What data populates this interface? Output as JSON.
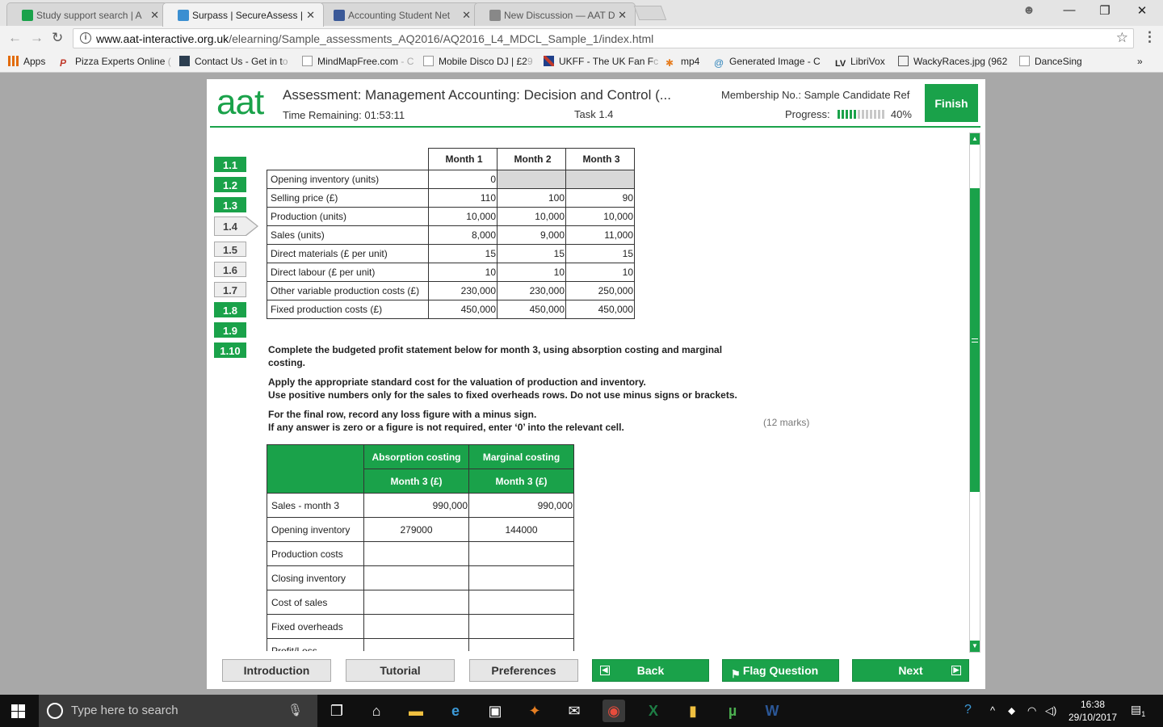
{
  "browser": {
    "tabs": [
      {
        "label": "Study support search | A",
        "favicon_color": "#1aa24a",
        "active": false
      },
      {
        "label": "Surpass | SecureAssess |",
        "favicon_color": "#3b8fd1",
        "active": true
      },
      {
        "label": "Accounting Student Net",
        "favicon_color": "#3b5998",
        "active": false
      },
      {
        "label": "New Discussion — AAT D",
        "favicon_color": "#888888",
        "active": false
      }
    ],
    "window_controls": {
      "profile": "☻",
      "minimize": "—",
      "restore": "❐",
      "close": "✕"
    },
    "url_host": "www.aat-interactive.org.uk",
    "url_path": "/elearning/Sample_assessments_AQ2016/AQ2016_L4_MDCL_Sample_1/index.html",
    "bookmarks": [
      {
        "label": "Apps",
        "tail": "",
        "icon_color": "#e26b0a"
      },
      {
        "label": "Pizza Experts Online",
        "tail": " (",
        "icon_color": "#c0392b"
      },
      {
        "label": "Contact Us - Get in t",
        "tail": "o",
        "icon_color": "#2c3e50"
      },
      {
        "label": "MindMapFree.com",
        "tail": " - C",
        "icon_color": "#ffffff"
      },
      {
        "label": "Mobile Disco DJ | £2",
        "tail": "9",
        "icon_color": "#ffffff"
      },
      {
        "label": "UKFF - The UK Fan F",
        "tail": "c",
        "icon_color": "#c0392b"
      },
      {
        "label": "mp4",
        "tail": "",
        "icon_color": "#e67e22"
      },
      {
        "label": "Generated Image - C",
        "tail": "",
        "icon_color": "#2980b9"
      },
      {
        "label": "LibriVox",
        "tail": "",
        "icon_color": "#333333"
      },
      {
        "label": "WackyRaces.jpg (962",
        "tail": "",
        "icon_color": "#555555"
      },
      {
        "label": "DanceSing",
        "tail": "",
        "icon_color": "#ffffff"
      }
    ],
    "more": "»"
  },
  "assessment": {
    "logo": "aat",
    "title": "Assessment: Management Accounting: Decision and Control (...",
    "time_label": "Time Remaining:",
    "time_value": "01:53:11",
    "task_label": "Task 1.4",
    "membership": "Membership No.: Sample Candidate Ref",
    "progress_label": "Progress:",
    "progress_percent": "40%",
    "progress_fraction": 0.4,
    "finish": "Finish"
  },
  "task_nav": [
    {
      "label": "1.1",
      "state": "answered"
    },
    {
      "label": "1.2",
      "state": "answered"
    },
    {
      "label": "1.3",
      "state": "answered"
    },
    {
      "label": "1.4",
      "state": "current"
    },
    {
      "label": "1.5",
      "state": "unanswered"
    },
    {
      "label": "1.6",
      "state": "unanswered"
    },
    {
      "label": "1.7",
      "state": "unanswered"
    },
    {
      "label": "1.8",
      "state": "answered"
    },
    {
      "label": "1.9",
      "state": "answered"
    },
    {
      "label": "1.10",
      "state": "answered"
    }
  ],
  "data_table": {
    "headers": [
      "Month 1",
      "Month 2",
      "Month 3"
    ],
    "rows": [
      {
        "label": "Opening inventory (units)",
        "values": [
          "0",
          "",
          ""
        ],
        "shaded": [
          false,
          true,
          true
        ]
      },
      {
        "label": "Selling price (£)",
        "values": [
          "110",
          "100",
          "90"
        ]
      },
      {
        "label": "Production (units)",
        "values": [
          "10,000",
          "10,000",
          "10,000"
        ]
      },
      {
        "label": "Sales (units)",
        "values": [
          "8,000",
          "9,000",
          "11,000"
        ]
      },
      {
        "label": "Direct materials  (£ per unit)",
        "values": [
          "15",
          "15",
          "15"
        ]
      },
      {
        "label": "Direct labour (£ per unit)",
        "values": [
          "10",
          "10",
          "10"
        ]
      },
      {
        "label": "Other variable production costs (£)",
        "values": [
          "230,000",
          "230,000",
          "250,000"
        ]
      },
      {
        "label": "Fixed production costs (£)",
        "values": [
          "450,000",
          "450,000",
          "450,000"
        ]
      }
    ]
  },
  "instructions": {
    "p1": "Complete the budgeted profit statement below for month 3, using absorption costing and marginal costing.",
    "p2": "Apply the appropriate standard cost for the valuation of production and inventory.",
    "p3": "Use positive numbers only for the sales to fixed overheads rows. Do not use minus signs or brackets.",
    "p4": "For the final row, record any loss figure with a minus sign.",
    "p5": "If any answer is zero or a figure is not required, enter ‘0’ into the relevant cell.",
    "marks": "(12 marks)"
  },
  "answer_table": {
    "header_absorption": "Absorption costing",
    "header_marginal": "Marginal costing",
    "sub_absorption": "Month 3 (£)",
    "sub_marginal": "Month 3 (£)",
    "rows": [
      {
        "label": "Sales - month 3",
        "absorption": "990,000",
        "marginal": "990,000",
        "align": "r"
      },
      {
        "label": "Opening inventory",
        "absorption": "279000",
        "marginal": "144000",
        "align": "c"
      },
      {
        "label": "Production costs",
        "absorption": "",
        "marginal": "",
        "align": "c"
      },
      {
        "label": "Closing inventory",
        "absorption": "",
        "marginal": "",
        "align": "c"
      },
      {
        "label": "Cost of sales",
        "absorption": "",
        "marginal": "",
        "align": "c"
      },
      {
        "label": "Fixed overheads",
        "absorption": "",
        "marginal": "",
        "align": "c"
      },
      {
        "label": "Profit/Loss",
        "absorption": "",
        "marginal": "",
        "align": "c"
      }
    ]
  },
  "bottom_buttons": {
    "introduction": "Introduction",
    "tutorial": "Tutorial",
    "preferences": "Preferences",
    "back": "Back",
    "flag": "Flag Question",
    "next": "Next"
  },
  "taskbar": {
    "search_placeholder": "Type here to search",
    "time": "16:38",
    "date": "29/10/2017",
    "notification_count": "1"
  }
}
